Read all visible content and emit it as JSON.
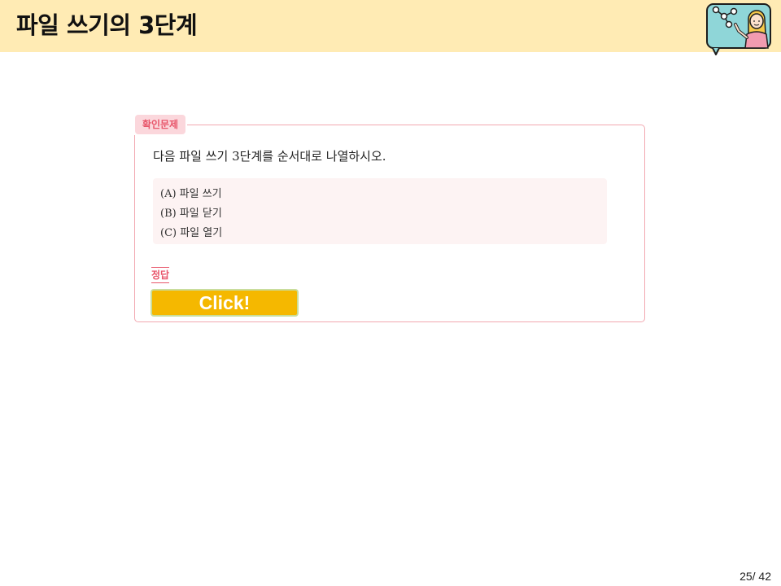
{
  "header": {
    "title": "파일 쓰기의 3단계",
    "background": "#ffebb4"
  },
  "quiz": {
    "badge": "확인문제",
    "question": "다음 파일 쓰기 3단계를 순서대로 나열하시오.",
    "options": [
      "(A) 파일 쓰기",
      "(B) 파일 닫기",
      "(C) 파일 열기"
    ],
    "answer_label": "정답",
    "accent_color": "#e8566b"
  },
  "click_button": {
    "label": "Click!",
    "color": "#f5b800"
  },
  "footer": {
    "page_number": "25/ 42"
  },
  "icons": {
    "teacher": "teacher-illustration-icon"
  }
}
